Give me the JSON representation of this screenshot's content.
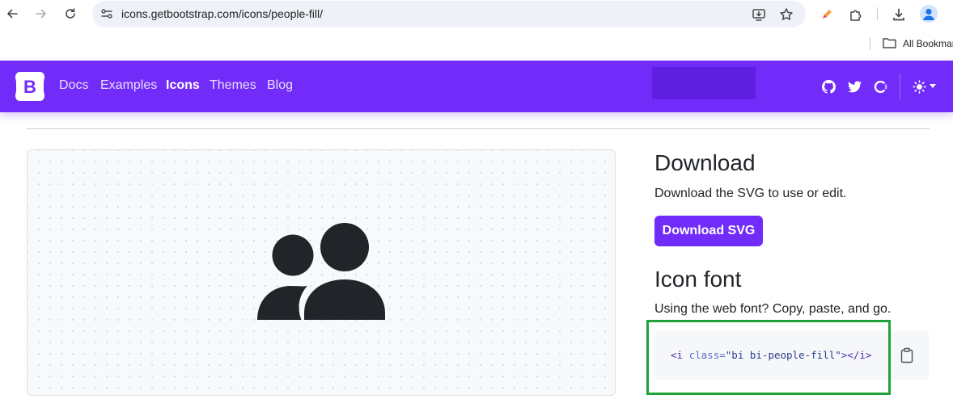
{
  "browser": {
    "url": "icons.getbootstrap.com/icons/people-fill/",
    "bookmarks_label": "All Bookmar",
    "icons": {
      "back": "arrow-left-icon",
      "forward": "arrow-right-icon",
      "reload": "reload-icon",
      "site_info": "site-settings-icon",
      "install": "install-app-icon",
      "bookmark": "star-icon",
      "extension_pen": "pen-extension-icon",
      "extensions": "puzzle-icon",
      "downloads": "download-icon",
      "profile": "profile-icon",
      "folder": "folder-icon"
    }
  },
  "navbar": {
    "links": [
      {
        "label": "Docs",
        "active": false
      },
      {
        "label": "Examples",
        "active": false
      },
      {
        "label": "Icons",
        "active": true
      },
      {
        "label": "Themes",
        "active": false
      },
      {
        "label": "Blog",
        "active": false
      }
    ],
    "brand_letter": "B",
    "icons": [
      "github-icon",
      "twitter-icon",
      "opencollective-icon",
      "sun-icon",
      "caret-down-icon"
    ],
    "accent_color": "#712cf9"
  },
  "main": {
    "preview_icon": "people-fill-icon",
    "download": {
      "heading": "Download",
      "text": "Download the SVG to use or edit.",
      "button_label": "Download SVG"
    },
    "icon_font": {
      "heading": "Icon font",
      "text": "Using the web font? Copy, paste, and go.",
      "code": {
        "open": "<i",
        "attr": "class",
        "eq": "=",
        "value": "\"bi bi-people-fill\"",
        "close": "></i>"
      },
      "copy_icon": "clipboard-icon"
    },
    "highlight_color": "#1fa23a"
  }
}
